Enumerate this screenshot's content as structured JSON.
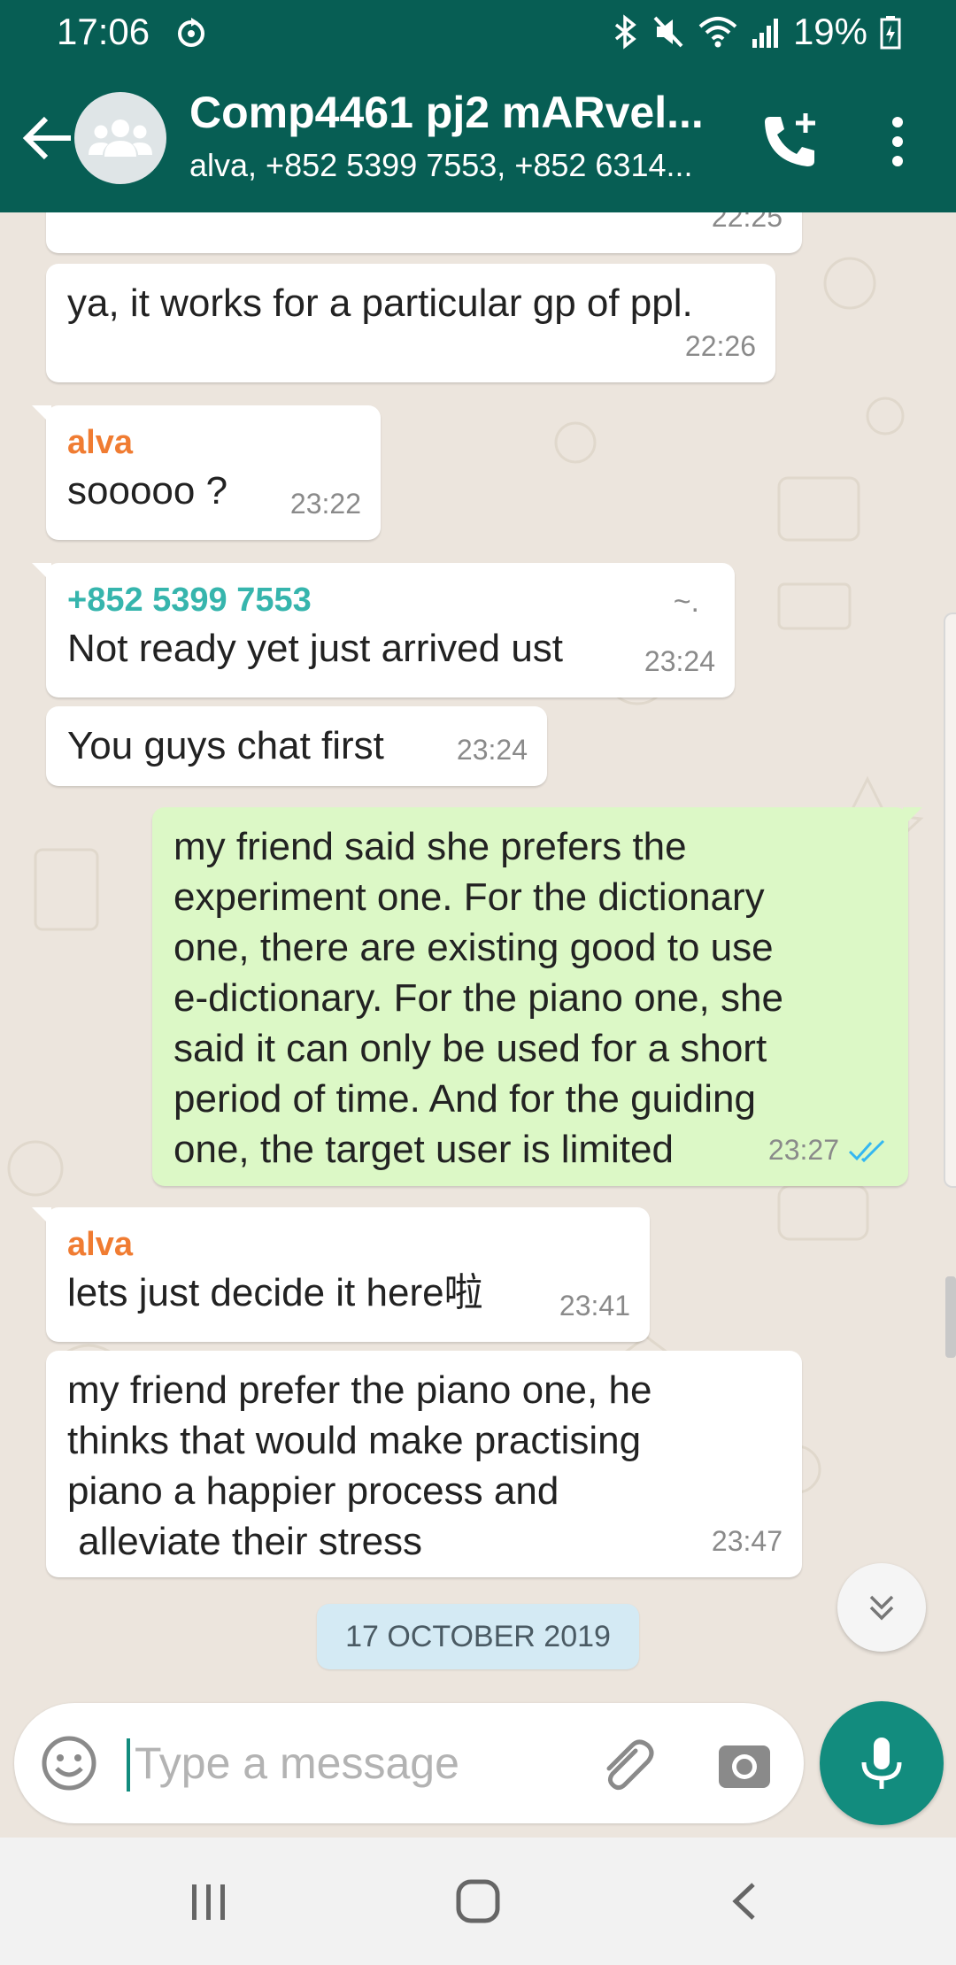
{
  "status_bar": {
    "time": "17:06",
    "battery": "19%",
    "icons": [
      "sync-icon",
      "bluetooth-icon",
      "mute-icon",
      "wifi-icon",
      "signal-icon",
      "battery-icon"
    ]
  },
  "header": {
    "title": "Comp4461 pj2 mARvel...",
    "subtitle": "alva, +852 5399 7553, +852 6314..."
  },
  "colors": {
    "header_bg": "#075e54",
    "accent": "#128c7e",
    "outgoing_bubble": "#dcf8c6",
    "incoming_bubble": "#ffffff",
    "sender_alva": "#f07c32",
    "sender_phone": "#36b5ad",
    "read_ticks": "#34b7f1",
    "date_chip": "#d4eaf4"
  },
  "messages": [
    {
      "type": "in",
      "text": "",
      "time": "22:25"
    },
    {
      "type": "in",
      "text": "ya, it works for a particular gp of ppl.",
      "time": "22:26"
    },
    {
      "type": "in",
      "sender": "alva",
      "text": "sooooo ?",
      "time": "23:22"
    },
    {
      "type": "in",
      "sender": "+852 5399 7553",
      "hint": "~.",
      "text": "Not ready yet just arrived ust",
      "time": "23:24"
    },
    {
      "type": "in",
      "text": "You guys chat first",
      "time": "23:24"
    },
    {
      "type": "out",
      "text": "my friend said she prefers the\nexperiment one. For the dictionary\none, there are existing good to use\ne-dictionary. For the piano one, she\nsaid it can only be used for a short\nperiod of time. And for the guiding\none, the target user is limited",
      "time": "23:27"
    },
    {
      "type": "in",
      "sender": "alva",
      "text": "lets just decide it here啦",
      "time": "23:41"
    },
    {
      "type": "in",
      "text": "my friend prefer the piano one, he\nthinks that would make practising\npiano a happier process and\n alleviate their stress",
      "time": "23:47"
    }
  ],
  "date_chip": "17 OCTOBER 2019",
  "composer": {
    "placeholder": "Type a message"
  }
}
